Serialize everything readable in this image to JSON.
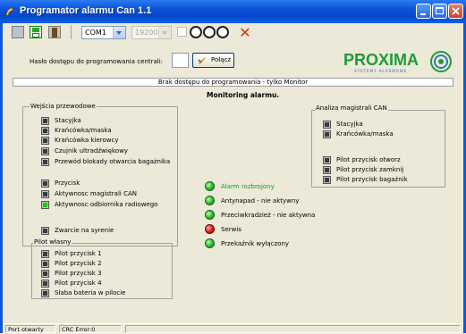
{
  "window": {
    "title": "Programator alarmu Can 1.1"
  },
  "toolbar": {
    "port_value": "COM1",
    "baud_value": "19200",
    "icons": [
      "open-folder-icon",
      "save-icon",
      "exit-icon",
      "circle-icon",
      "circle-icon",
      "circle-icon",
      "red-x-icon"
    ]
  },
  "access": {
    "label": "Hasło dostępu do programowania centrali:",
    "password_value": "",
    "connect_label": "Połącz"
  },
  "logo": {
    "name": "PROXIMA",
    "tagline": "SYSTEMY ALARMOWE"
  },
  "status_line": "Brak dostępu do programowania - tylko Monitor",
  "monitor_title": "Monitoring alarmu.",
  "inputs_group": {
    "title": "Wejścia przewodowe",
    "items": [
      {
        "label": "Stacyjka",
        "active": false
      },
      {
        "label": "Krańcówka/maska",
        "active": false
      },
      {
        "label": "Krańcówka kierowcy",
        "active": false
      },
      {
        "label": "Czujnik ultradźwiękowy",
        "active": false
      },
      {
        "label": "Przewód blokady otwarcia bagażnika",
        "active": false
      },
      {
        "label": "Przycisk",
        "active": false
      },
      {
        "label": "Aktywnosc magistrali CAN",
        "active": false
      },
      {
        "label": "Aktywnosc odbiornika radiowego",
        "active": true
      },
      {
        "label": "Zwarcie na syrenie",
        "active": false
      }
    ]
  },
  "remote_group": {
    "title": "Pilot własny",
    "items": [
      {
        "label": "Pilot przycisk 1",
        "active": false
      },
      {
        "label": "Pilot przycisk 2",
        "active": false
      },
      {
        "label": "Pilot przycisk 3",
        "active": false
      },
      {
        "label": "Pilot przycisk 4",
        "active": false
      },
      {
        "label": "Słaba bateria w pilocie",
        "active": false
      }
    ]
  },
  "can_group": {
    "title": "Analiza magistrali CAN",
    "items": [
      {
        "label": "Stacyjka",
        "active": false
      },
      {
        "label": "Krańcówka/maska",
        "active": false
      },
      {
        "label": "Pilot przycisk otworz",
        "active": false
      },
      {
        "label": "Pilot przycisk zamknij",
        "active": false
      },
      {
        "label": "Pilot przycisk bagażnik",
        "active": false
      }
    ]
  },
  "status_leds": [
    {
      "label": "Alarm rozbrojony",
      "color": "green",
      "highlight": true
    },
    {
      "label": "Antynapad - nie aktywny",
      "color": "green",
      "highlight": false
    },
    {
      "label": "Przeciwkradzież - nie aktywna",
      "color": "green",
      "highlight": false
    },
    {
      "label": "Serwis",
      "color": "red",
      "highlight": false
    },
    {
      "label": "Przekaźnik wyłączony",
      "color": "green",
      "highlight": false
    }
  ],
  "statusbar": {
    "port": "Port otwarty",
    "crc": "CRC Error:0"
  }
}
